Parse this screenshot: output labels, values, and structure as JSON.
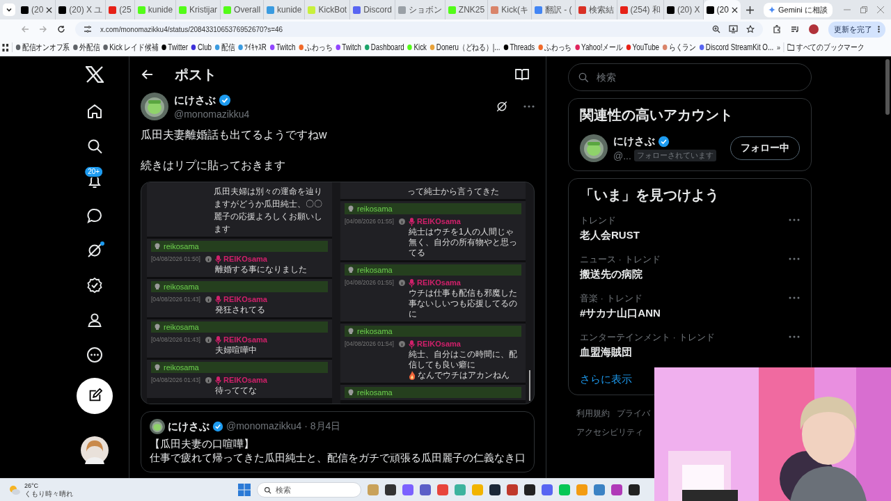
{
  "browser": {
    "tabs": [
      {
        "title": "(20",
        "color": "#000000",
        "selected": false,
        "close": true
      },
      {
        "title": "(20) X ユ",
        "color": "#000000",
        "selected": false,
        "close": false
      },
      {
        "title": "(25",
        "color": "#e62117",
        "selected": false,
        "close": false
      },
      {
        "title": "kunide",
        "color": "#53fc18",
        "selected": false,
        "close": false
      },
      {
        "title": "Kristijar",
        "color": "#53fc18",
        "selected": false,
        "close": false
      },
      {
        "title": "Overall",
        "color": "#53fc18",
        "selected": false,
        "close": false
      },
      {
        "title": "kunide",
        "color": "#3a9be0",
        "selected": false,
        "close": false
      },
      {
        "title": "KickBot",
        "color": "#c8f03c",
        "selected": false,
        "close": false
      },
      {
        "title": "Discord",
        "color": "#5865f2",
        "selected": false,
        "close": false
      },
      {
        "title": "ショボン",
        "color": "#9aa0a6",
        "selected": false,
        "close": false
      },
      {
        "title": "ZNK25",
        "color": "#53fc18",
        "selected": false,
        "close": false
      },
      {
        "title": "Kick(キ",
        "color": "#d9846a",
        "selected": false,
        "close": false
      },
      {
        "title": "翻訳 - (",
        "color": "#4285f4",
        "selected": false,
        "close": false
      },
      {
        "title": "検索結",
        "color": "#d93025",
        "selected": false,
        "close": false
      },
      {
        "title": "(254) 和",
        "color": "#e62117",
        "selected": false,
        "close": false
      },
      {
        "title": "(20) X",
        "color": "#000000",
        "selected": false,
        "close": false
      },
      {
        "title": "(20",
        "color": "#000000",
        "selected": true,
        "close": true
      }
    ],
    "gemini": "Gemini に相談",
    "url": "x.com/monomazikku4/status/2084331065376952670?s=46",
    "update": "更新を完了",
    "bookmarks": [
      {
        "label": "配信オンオフ系",
        "color": "#5f6368"
      },
      {
        "label": "外配信",
        "color": "#5f6368"
      },
      {
        "label": "Kick レイド候補",
        "color": "#5f6368"
      },
      {
        "label": "Twitter",
        "color": "#000000"
      },
      {
        "label": "Club",
        "color": "#3b2fd9"
      },
      {
        "label": "配信",
        "color": "#3a9be0"
      },
      {
        "label": "ﾂｲｷｬｽR",
        "color": "#3a9be0"
      },
      {
        "label": "Twitch",
        "color": "#9146ff"
      },
      {
        "label": "ふわっち",
        "color": "#f06a2a"
      },
      {
        "label": "Twitch",
        "color": "#9146ff"
      },
      {
        "label": "Dashboard",
        "color": "#1aa36b"
      },
      {
        "label": "Kick",
        "color": "#53fc18"
      },
      {
        "label": "Doneru（どねる）|...",
        "color": "#e8a23a"
      },
      {
        "label": "Threads",
        "color": "#000000"
      },
      {
        "label": "ふわっち",
        "color": "#f06a2a"
      },
      {
        "label": "Yahoo!メール",
        "color": "#e0245e"
      },
      {
        "label": "YouTube",
        "color": "#e62117"
      },
      {
        "label": "らくラン",
        "color": "#d9846a"
      },
      {
        "label": "Discord StreamKit O...",
        "color": "#5865f2"
      }
    ],
    "more_bookmarks": "»",
    "all_bookmarks": "すべてのブックマーク"
  },
  "nav": [
    {
      "kind": "home",
      "dot": false
    },
    {
      "kind": "search",
      "dot": false
    },
    {
      "kind": "notifications",
      "dot": false,
      "badge": "20+"
    },
    {
      "kind": "messages",
      "dot": false
    },
    {
      "kind": "grok",
      "dot": true
    },
    {
      "kind": "verified",
      "dot": false
    },
    {
      "kind": "profile",
      "dot": false
    },
    {
      "kind": "more",
      "dot": false
    }
  ],
  "post": {
    "header": "ポスト",
    "author": "にけさぶ",
    "handle": "@monomazikku4",
    "lines": [
      "瓜田夫妻離婚話も出てるようですねw",
      "続きはリプに貼っておきます"
    ],
    "chat": [
      {
        "continuation": "瓜田夫婦は別々の運命を辿りますがどうか瓜田純士、〇〇麗子の応援よろしくお願いします",
        "messages": [
          {
            "header": "reikosama",
            "time": "[04/08/2026 01:50]",
            "user": "REIKOsama",
            "text": "離婚する事になりました"
          },
          {
            "header": "reikosama",
            "time": "[04/08/2026 01:43]",
            "user": "REIKOsama",
            "text": "発狂されてる"
          },
          {
            "header": "reikosama",
            "time": "[04/08/2026 01:43]",
            "user": "REIKOsama",
            "text": "夫婦喧嘩中"
          },
          {
            "header": "reikosama",
            "time": "[04/08/2026 01:43]",
            "user": "REIKOsama",
            "text": "待っててな"
          }
        ]
      },
      {
        "continuation": "って純士から言うてきた",
        "messages": [
          {
            "header": "reikosama",
            "time": "[04/08/2026 01:55]",
            "user": "REIKOsama",
            "text": "純士はウチを1人の人間じゃ無く、自分の所有物やと思ってる"
          },
          {
            "header": "reikosama",
            "time": "[04/08/2026 01:55]",
            "user": "REIKOsama",
            "text": "ウチは仕事も配信も邪魔した事ないしいつも応援してるのに"
          },
          {
            "header": "reikosama",
            "time": "[04/08/2026 01:54]",
            "user": "REIKOsama",
            "text": "純士、自分はこの時間に、配信しても良い癖に",
            "text_after": "なんでウチはアカンねん"
          },
          {
            "header": "reikosama"
          }
        ]
      }
    ],
    "quote": {
      "author": "にけさぶ",
      "meta": "@monomazikku4 · 8月4日",
      "lines": [
        "【瓜田夫妻の口喧嘩】",
        "仕事で疲れて帰ってきた瓜田純士と、配信をガチで頑張る瓜田麗子の仁義なき口"
      ]
    }
  },
  "sidebar": {
    "search_placeholder": "検索",
    "related": {
      "title": "関連性の高いアカウント",
      "name": "にけさぶ",
      "handle": "@...",
      "follows_you": "フォローされています",
      "button": "フォロー中"
    },
    "trends": {
      "title": "「いま」を見つけよう",
      "items": [
        {
          "category": "トレンド",
          "title": "老人会RUST"
        },
        {
          "category": "ニュース · トレンド",
          "title": "搬送先の病院"
        },
        {
          "category": "音楽 · トレンド",
          "title": "#サカナ山口ANN"
        },
        {
          "category": "エンターテインメント · トレンド",
          "title": "血盟海賊団"
        }
      ],
      "more": "さらに表示"
    },
    "footer": [
      "利用規約",
      "プライバ",
      "アクセシビリティ"
    ]
  },
  "taskbar": {
    "temperature": "26°C",
    "weather": "くもり時々晴れ",
    "search_placeholder": "検索",
    "apps": [
      {
        "color": "#c9a25a"
      },
      {
        "color": "#333333"
      },
      {
        "color": "#7b61ff"
      },
      {
        "color": "#5b5fc7"
      },
      {
        "color": "#e8453c"
      },
      {
        "color": "#3db39e"
      },
      {
        "color": "#f2b400"
      },
      {
        "color": "#1b2838"
      },
      {
        "color": "#c0392b"
      },
      {
        "color": "#222222"
      },
      {
        "color": "#5865f2"
      },
      {
        "color": "#06c755"
      },
      {
        "color": "#f39c12"
      },
      {
        "color": "#3b82c4"
      },
      {
        "color": "#b03ab8"
      },
      {
        "color": "#222222"
      }
    ]
  }
}
